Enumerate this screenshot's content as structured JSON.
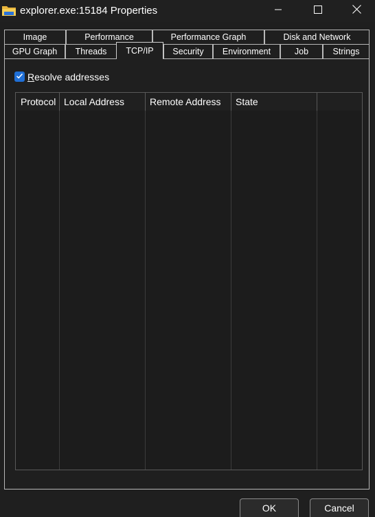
{
  "window": {
    "title": "explorer.exe:15184 Properties",
    "app_icon": "folder-icon"
  },
  "caption_buttons": [
    "minimize-icon",
    "maximize-icon",
    "close-icon"
  ],
  "tabs_row1": [
    "Image",
    "Performance",
    "Performance Graph",
    "Disk and Network"
  ],
  "tabs_row2": [
    "GPU Graph",
    "Threads",
    "TCP/IP",
    "Security",
    "Environment",
    "Job",
    "Strings"
  ],
  "active_tab": "TCP/IP",
  "resolve": {
    "checked": true,
    "accel": "R",
    "rest": "esolve addresses"
  },
  "table": {
    "columns": [
      "Protocol",
      "Local Address",
      "Remote Address",
      "State"
    ],
    "sorted_column": "Protocol",
    "rows": []
  },
  "buttons": {
    "ok": "OK",
    "cancel": "Cancel"
  },
  "colors": {
    "background": "#1f1f1f",
    "accent": "#1f6fd6",
    "border": "#b9b9b9"
  }
}
